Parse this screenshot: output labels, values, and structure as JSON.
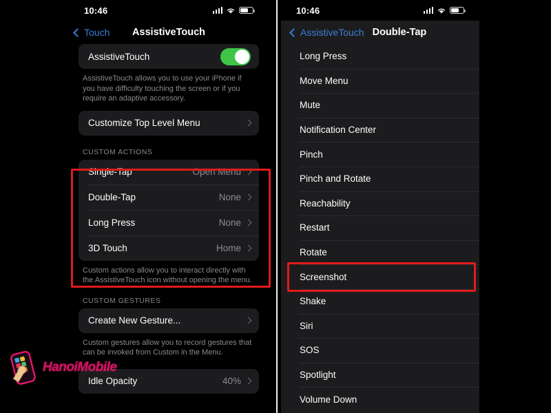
{
  "meta": {
    "watermark_text": "HanoiMobile",
    "annotation_color": "#e01b1b",
    "accent_blue": "#3b7fd4",
    "toggle_green": "#3ec547",
    "panel_bg": "#1c1c1e",
    "screen_bg": "#000000"
  },
  "left_phone": {
    "status": {
      "time": "10:46",
      "cellular_icon": "cellular-bars-icon",
      "wifi_icon": "wifi-icon",
      "battery_icon": "battery-icon",
      "battery_level_pct": 62
    },
    "nav": {
      "back_label": "Touch",
      "back_icon": "chevron-left-icon",
      "title": "AssistiveTouch"
    },
    "assistive_touch": {
      "label": "AssistiveTouch",
      "toggle_state": "on",
      "footnote": "AssistiveTouch allows you to use your iPhone if you have difficulty touching the screen or if you require an adaptive accessory."
    },
    "customize_menu": {
      "label": "Customize Top Level Menu",
      "chevron_icon": "chevron-right-icon"
    },
    "custom_actions": {
      "header": "CUSTOM ACTIONS",
      "rows": [
        {
          "label": "Single-Tap",
          "value": "Open Menu"
        },
        {
          "label": "Double-Tap",
          "value": "None"
        },
        {
          "label": "Long Press",
          "value": "None"
        },
        {
          "label": "3D Touch",
          "value": "Home"
        }
      ],
      "footnote": "Custom actions allow you to interact directly with the AssistiveTouch icon without opening the menu."
    },
    "custom_gestures": {
      "header": "CUSTOM GESTURES",
      "row_label": "Create New Gesture...",
      "footnote": "Custom gestures allow you to record gestures that can be invoked from Custom in the Menu."
    },
    "idle_opacity": {
      "label": "Idle Opacity",
      "value": "40%"
    }
  },
  "right_phone": {
    "status": {
      "time": "10:46",
      "cellular_icon": "cellular-bars-icon",
      "wifi_icon": "wifi-icon",
      "battery_icon": "battery-icon",
      "battery_level_pct": 62
    },
    "nav": {
      "back_label": "AssistiveTouch",
      "back_icon": "chevron-left-icon",
      "title": "Double-Tap"
    },
    "action_list": [
      "Long Press",
      "Move Menu",
      "Mute",
      "Notification Center",
      "Pinch",
      "Pinch and Rotate",
      "Reachability",
      "Restart",
      "Rotate",
      "Screenshot",
      "Shake",
      "Siri",
      "SOS",
      "Spotlight",
      "Volume Down"
    ],
    "highlighted_item": "Screenshot"
  }
}
